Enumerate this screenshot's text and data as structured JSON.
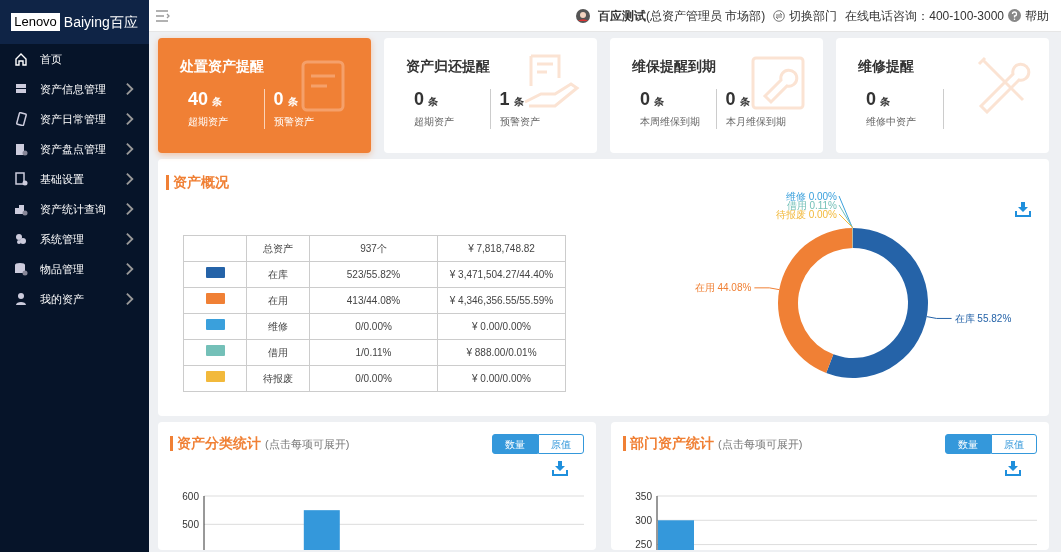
{
  "logo": {
    "brand": "Lenovo",
    "product": "Baiying百应"
  },
  "sidebar": {
    "items": [
      {
        "label": "首页",
        "has_children": false
      },
      {
        "label": "资产信息管理",
        "has_children": true
      },
      {
        "label": "资产日常管理",
        "has_children": true
      },
      {
        "label": "资产盘点管理",
        "has_children": true
      },
      {
        "label": "基础设置",
        "has_children": true
      },
      {
        "label": "资产统计查询",
        "has_children": true
      },
      {
        "label": "系统管理",
        "has_children": true
      },
      {
        "label": "物品管理",
        "has_children": true
      },
      {
        "label": "我的资产",
        "has_children": true
      }
    ]
  },
  "topbar": {
    "user": "百应测试",
    "role": "(总资产管理员 市场部)",
    "switch": "切换部门",
    "hotline": "在线电话咨询：400-100-3000",
    "help": "帮助"
  },
  "reminders": [
    {
      "title": "处置资产提醒",
      "active": true,
      "stats": [
        {
          "value": "40",
          "unit": "条",
          "label": "超期资产"
        },
        {
          "value": "0",
          "unit": "条",
          "label": "预警资产"
        }
      ]
    },
    {
      "title": "资产归还提醒",
      "active": false,
      "stats": [
        {
          "value": "0",
          "unit": "条",
          "label": "超期资产"
        },
        {
          "value": "1",
          "unit": "条",
          "label": "预警资产"
        }
      ]
    },
    {
      "title": "维保提醒到期",
      "active": false,
      "stats": [
        {
          "value": "0",
          "unit": "条",
          "label": "本周维保到期"
        },
        {
          "value": "0",
          "unit": "条",
          "label": "本月维保到期"
        }
      ]
    },
    {
      "title": "维修提醒",
      "active": false,
      "stats": [
        {
          "value": "0",
          "unit": "条",
          "label": "维修中资产"
        }
      ]
    }
  ],
  "overview": {
    "title": "资产概况",
    "summary": {
      "label": "总资产",
      "count": "937个",
      "value": "¥ 7,818,748.82"
    },
    "rows": [
      {
        "label": "在库",
        "count": "523/55.82%",
        "value": "¥ 3,471,504.27/44.40%",
        "color": "#2563a8"
      },
      {
        "label": "在用",
        "count": "413/44.08%",
        "value": "¥ 4,346,356.55/55.59%",
        "color": "#f08035"
      },
      {
        "label": "维修",
        "count": "0/0.00%",
        "value": "¥ 0.00/0.00%",
        "color": "#3aa0dc"
      },
      {
        "label": "借用",
        "count": "1/0.11%",
        "value": "¥ 888.00/0.01%",
        "color": "#74c0b8"
      },
      {
        "label": "待报废",
        "count": "0/0.00%",
        "value": "¥ 0.00/0.00%",
        "color": "#f2b93b"
      }
    ],
    "chart_data": {
      "type": "donut",
      "series": [
        {
          "values": [
            55.82,
            44.08,
            0,
            0.11,
            0
          ]
        }
      ],
      "value_labels": [
        "在库 55.82%",
        "在用 44.08%",
        "维修 0.00%",
        "借用 0.11%",
        "待报废 0.00%"
      ]
    }
  },
  "stat_panels": [
    {
      "title": "资产分类统计",
      "hint": "(点击每项可展开)",
      "toggle": [
        {
          "label": "数量",
          "selected": true
        },
        {
          "label": "原值",
          "selected": false
        }
      ],
      "chart_data": {
        "type": "bar",
        "series": [
          {
            "color": "#3498db",
            "values": [
              550
            ]
          }
        ],
        "ylim": [
          0,
          600
        ],
        "yticks": [
          500,
          600
        ]
      }
    },
    {
      "title": "部门资产统计",
      "hint": "(点击每项可展开)",
      "toggle": [
        {
          "label": "数量",
          "selected": true
        },
        {
          "label": "原值",
          "selected": false
        }
      ],
      "chart_data": {
        "type": "bar",
        "series": [
          {
            "color": "#3498db",
            "values": [
              300
            ]
          }
        ],
        "ylim": [
          0,
          350
        ],
        "yticks": [
          250,
          300,
          350
        ]
      }
    }
  ]
}
